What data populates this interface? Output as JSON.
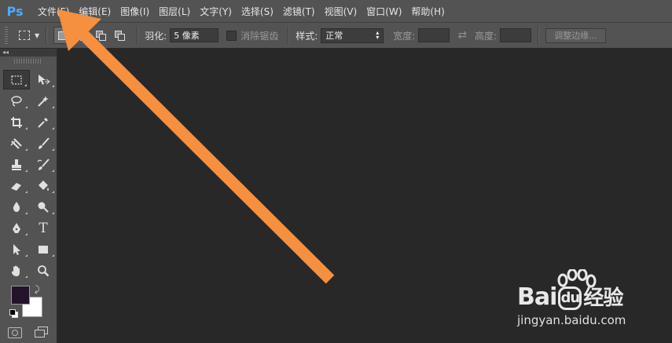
{
  "app": {
    "logo_text": "Ps"
  },
  "menu": [
    {
      "label": "文件(F)",
      "key": "file"
    },
    {
      "label": "编辑(E)",
      "key": "edit"
    },
    {
      "label": "图像(I)",
      "key": "image"
    },
    {
      "label": "图层(L)",
      "key": "layer"
    },
    {
      "label": "文字(Y)",
      "key": "type"
    },
    {
      "label": "选择(S)",
      "key": "select"
    },
    {
      "label": "滤镜(T)",
      "key": "filter"
    },
    {
      "label": "视图(V)",
      "key": "view"
    },
    {
      "label": "窗口(W)",
      "key": "window"
    },
    {
      "label": "帮助(H)",
      "key": "help"
    }
  ],
  "options": {
    "feather_label": "羽化:",
    "feather_value": "5 像素",
    "antialias_label": "消除锯齿",
    "style_label": "样式:",
    "style_value": "正常",
    "width_label": "宽度:",
    "height_label": "高度:",
    "refine_edge_label": "调整边缘..."
  },
  "toolbox": {
    "collapse_label": "◂◂",
    "tools": [
      {
        "name": "rectangular-marquee-tool",
        "icon": "marquee-icon",
        "active": true
      },
      {
        "name": "move-tool",
        "icon": "move-icon"
      },
      {
        "name": "lasso-tool",
        "icon": "lasso-icon"
      },
      {
        "name": "magic-wand-tool",
        "icon": "magic-wand-icon"
      },
      {
        "name": "crop-tool",
        "icon": "crop-icon"
      },
      {
        "name": "eyedropper-tool",
        "icon": "eyedropper-icon"
      },
      {
        "name": "healing-brush-tool",
        "icon": "bandage-icon"
      },
      {
        "name": "brush-tool",
        "icon": "brush-icon"
      },
      {
        "name": "clone-stamp-tool",
        "icon": "stamp-icon"
      },
      {
        "name": "history-brush-tool",
        "icon": "history-brush-icon"
      },
      {
        "name": "eraser-tool",
        "icon": "eraser-icon"
      },
      {
        "name": "paint-bucket-tool",
        "icon": "bucket-icon"
      },
      {
        "name": "blur-tool",
        "icon": "droplet-icon"
      },
      {
        "name": "dodge-tool",
        "icon": "dodge-icon"
      },
      {
        "name": "pen-tool",
        "icon": "pen-icon"
      },
      {
        "name": "type-tool",
        "icon": "type-icon",
        "glyph": "T"
      },
      {
        "name": "path-selection-tool",
        "icon": "arrow-cursor-icon"
      },
      {
        "name": "rectangle-tool",
        "icon": "rectangle-icon"
      },
      {
        "name": "hand-tool",
        "icon": "hand-icon"
      },
      {
        "name": "zoom-tool",
        "icon": "magnifier-icon"
      }
    ],
    "foreground_color": "#24132a",
    "background_color": "#ffffff"
  },
  "colors": {
    "chrome": "#535353",
    "workspace": "#282828",
    "arrow": "#f5903f",
    "ps_blue": "#4ea9ff",
    "baidu_red": "#de2910"
  },
  "watermark": {
    "brand_prefix": "Bai",
    "brand_suffix": "经验",
    "url": "jingyan.baidu.com"
  }
}
